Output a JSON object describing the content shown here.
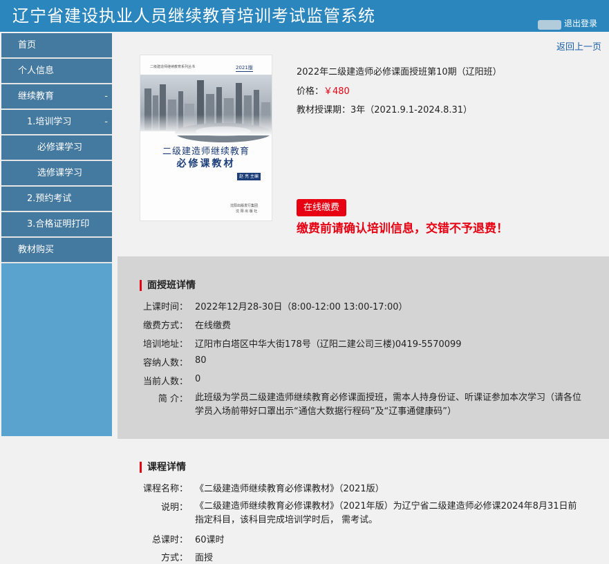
{
  "header": {
    "title": "辽宁省建设执业人员继续教育培训考试监管系统",
    "logout_label": "退出登录"
  },
  "sidebar": {
    "items": [
      {
        "label": "首页",
        "toggle": ""
      },
      {
        "label": "个人信息",
        "toggle": ""
      },
      {
        "label": "继续教育",
        "toggle": "-"
      },
      {
        "label": "1.培训学习",
        "toggle": "-"
      },
      {
        "label": "必修课学习",
        "toggle": ""
      },
      {
        "label": "选修课学习",
        "toggle": ""
      },
      {
        "label": "2.预约考试",
        "toggle": ""
      },
      {
        "label": "3.合格证明打印",
        "toggle": ""
      },
      {
        "label": "教材购买",
        "toggle": ""
      }
    ]
  },
  "back_link": "返回上一页",
  "book_cover": {
    "series": "二级建造师继续教育系列丛书",
    "edition": "2021版",
    "title_line1": "二级建造师继续教育",
    "title_line2": "必修课教材",
    "author": "赵 亮 主编",
    "publisher_line1": "沈阳出版发行集团",
    "publisher_line2": "沈 阳 出 版 社"
  },
  "product": {
    "name": "2022年二级建造师必修课面授班第10期（辽阳班）",
    "price_label": "价格：",
    "price_value": "￥480",
    "period_label": "教材授课期：",
    "period_value": "3年（2021.9.1-2024.8.31）",
    "pay_button": "在线缴费",
    "warning": "缴费前请确认培训信息，交错不予退费！"
  },
  "class_details": {
    "title": "面授班详情",
    "rows": [
      {
        "label": "上课时间：",
        "value": "2022年12月28-30日（8:00-12:00 13:00-17:00）"
      },
      {
        "label": "缴费方式：",
        "value": "在线缴费"
      },
      {
        "label": "培训地址：",
        "value": "辽阳市白塔区中华大街178号（辽阳二建公司三楼)0419-5570099"
      },
      {
        "label": "容纳人数：",
        "value": "80"
      },
      {
        "label": "当前人数：",
        "value": "0"
      },
      {
        "label": "简 介：",
        "value": "此班级为学员二级建造师继续教育必修课面授班，需本人持身份证、听课证参加本次学习（请各位学员入场前带好口罩出示“通信大数据行程码”及“辽事通健康码”）"
      }
    ]
  },
  "course_details": {
    "title": "课程详情",
    "rows": [
      {
        "label": "课程名称：",
        "value": "《二级建造师继续教育必修课教材》（2021版）"
      },
      {
        "label": "说明：",
        "value": "《二级建造师继续教育必修课教材》（2021年版）为辽宁省二级建造师必修课2024年8月31日前指定科目，该科目完成培训学时后， 需考试。"
      },
      {
        "label": "总课时：",
        "value": "60课时"
      },
      {
        "label": "方式：",
        "value": "面授"
      }
    ]
  },
  "colors": {
    "header": "#2b86bd",
    "sidebar_item": "#4479a0",
    "sidebar_bg": "#5aa3cf",
    "accent_red": "#e60012",
    "panel_gray": "#d4d4d4",
    "page_bg": "#f1f1f1"
  }
}
